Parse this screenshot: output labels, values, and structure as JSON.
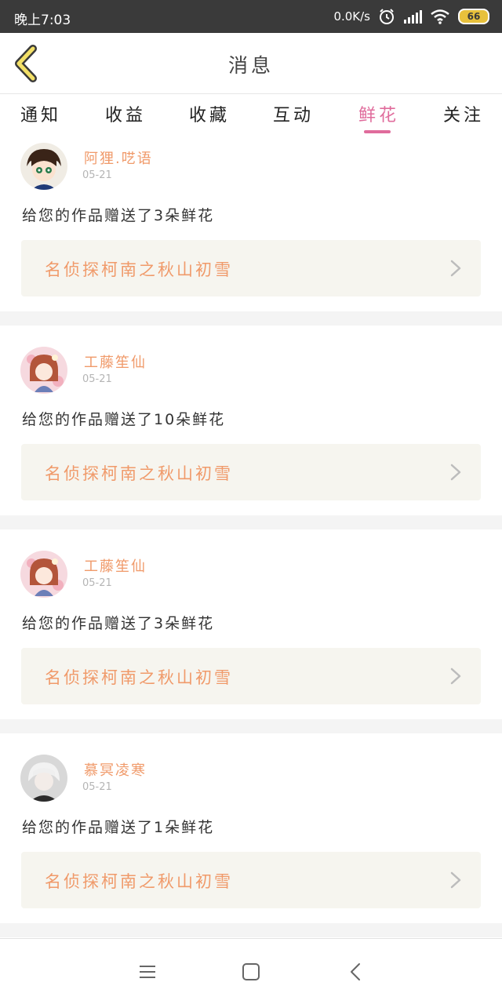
{
  "status_bar": {
    "time": "晚上7:03",
    "net_speed": "0.0K/s",
    "battery": "66",
    "icons": [
      "alarm-icon",
      "signal-icon",
      "wifi-icon",
      "battery-icon"
    ]
  },
  "header": {
    "title": "消息",
    "back_icon": "chevron-left-icon"
  },
  "tabs": [
    {
      "label": "通知"
    },
    {
      "label": "收益"
    },
    {
      "label": "收藏"
    },
    {
      "label": "互动"
    },
    {
      "label": "鲜花",
      "active": true
    },
    {
      "label": "关注"
    }
  ],
  "messages": [
    {
      "user": "阿狸.呓语",
      "date": "05-21",
      "text": "给您的作品赠送了3朵鲜花",
      "work": "名侦探柯南之秋山初雪"
    },
    {
      "user": "工藤笙仙",
      "date": "05-21",
      "text": "给您的作品赠送了10朵鲜花",
      "work": "名侦探柯南之秋山初雪"
    },
    {
      "user": "工藤笙仙",
      "date": "05-21",
      "text": "给您的作品赠送了3朵鲜花",
      "work": "名侦探柯南之秋山初雪"
    },
    {
      "user": "慕冥凌寒",
      "date": "05-21",
      "text": "给您的作品赠送了1朵鲜花",
      "work": "名侦探柯南之秋山初雪"
    }
  ],
  "colors": {
    "accent": "#e06c9c",
    "username": "#f09a6a",
    "card_bg": "#f6f5ef",
    "status_bar": "#3a3a3a"
  },
  "nav_bar": {
    "icons": [
      "menu-icon",
      "home-square-icon",
      "back-triangle-icon"
    ]
  }
}
